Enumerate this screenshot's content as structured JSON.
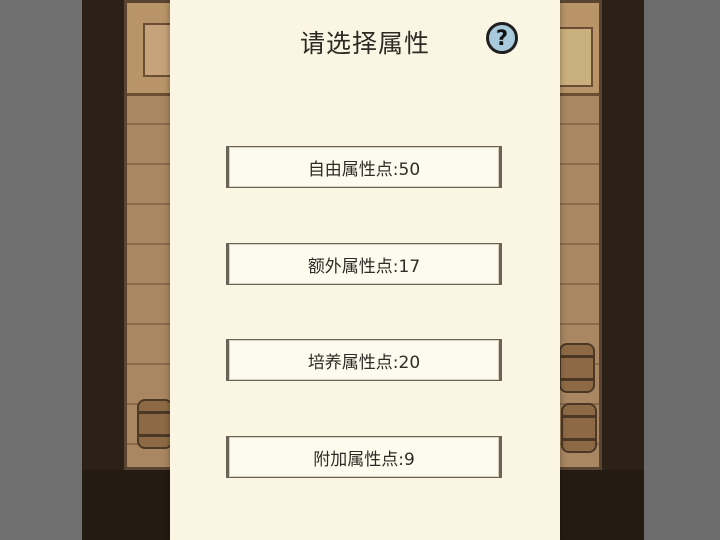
{
  "dialog": {
    "title": "请选择属性",
    "help_label": "?",
    "options": [
      {
        "label": "自由属性点:50"
      },
      {
        "label": "额外属性点:17"
      },
      {
        "label": "培养属性点:20"
      },
      {
        "label": "附加属性点:9"
      }
    ]
  },
  "colors": {
    "dialog_bg": "#fbf6e4",
    "help_icon_fill": "#a9c9dc",
    "scene_wood": "#a98762"
  }
}
